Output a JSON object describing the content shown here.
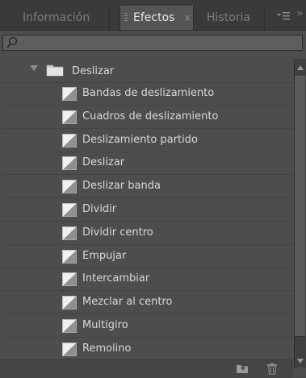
{
  "tabs": [
    {
      "label": "Información"
    },
    {
      "label": "Efectos",
      "close": "×"
    },
    {
      "label": "Historia"
    }
  ],
  "search": {
    "value": "",
    "placeholder": ""
  },
  "folder": {
    "label": "Deslizar"
  },
  "effects": [
    "Bandas de deslizamiento",
    "Cuadros de deslizamiento",
    "Deslizamiento partido",
    "Deslizar",
    "Deslizar banda",
    "Dividir",
    "Dividir centro",
    "Empujar",
    "Intercambiar",
    "Mezclar al centro",
    "Multigiro",
    "Remolino"
  ],
  "icons": {
    "search": "search-icon",
    "folder": "folder-icon",
    "effect": "transition-effect-icon",
    "new_bin": "new-bin-icon",
    "trash": "trash-icon",
    "panel_menu": "panel-menu-icon"
  },
  "colors": {
    "panel": "#4d4d4d",
    "tabbar": "#3a3a3a",
    "text": "#d8d8d8"
  }
}
